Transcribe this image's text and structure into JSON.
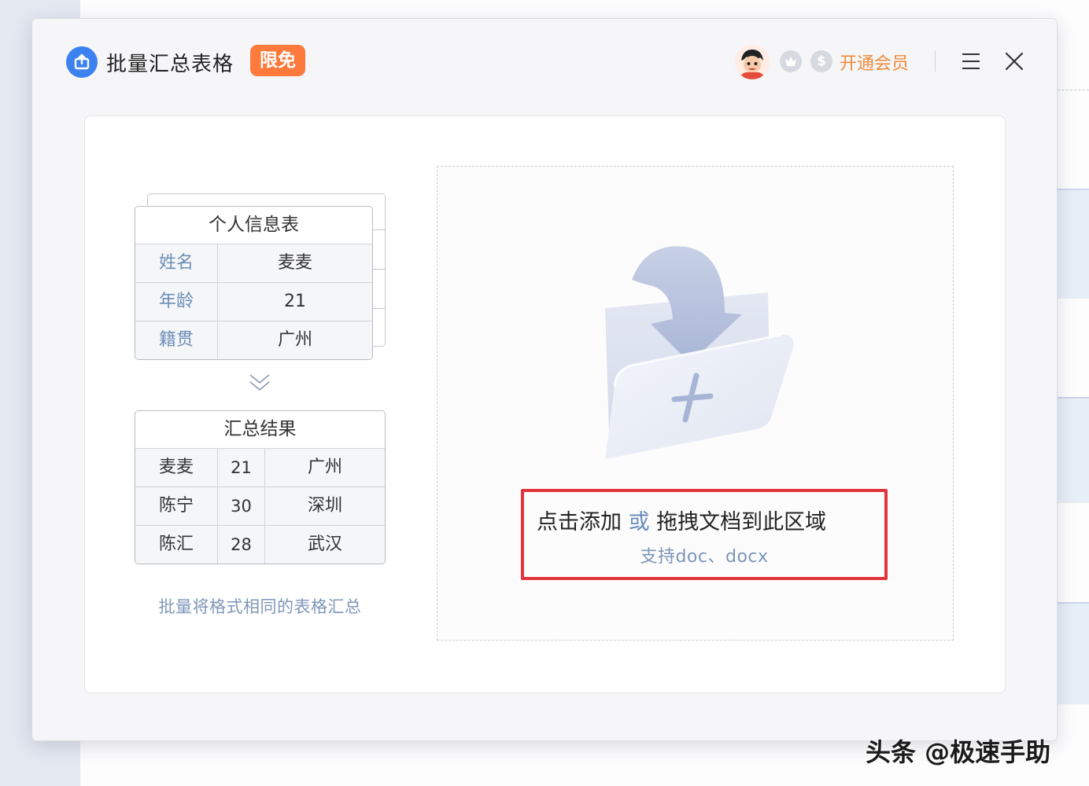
{
  "window": {
    "title": "批量汇总表格",
    "badge": "限免",
    "vip_label": "开通会员",
    "coin_symbol": "$"
  },
  "demo": {
    "source_table": {
      "title": "个人信息表",
      "rows": [
        {
          "key": "姓名",
          "value": "麦麦"
        },
        {
          "key": "年龄",
          "value": "21"
        },
        {
          "key": "籍贯",
          "value": "广州"
        }
      ]
    },
    "result_table": {
      "title": "汇总结果",
      "rows": [
        [
          "麦麦",
          "21",
          "广州"
        ],
        [
          "陈宁",
          "30",
          "深圳"
        ],
        [
          "陈汇",
          "28",
          "武汉"
        ]
      ]
    },
    "caption": "批量将格式相同的表格汇总"
  },
  "dropzone": {
    "hint_part1": "点击添加",
    "hint_or": "或",
    "hint_part2": "拖拽文档到此区域",
    "formats": "支持doc、docx"
  },
  "watermark": "头条 @极速手助",
  "colors": {
    "accent": "#3b82f0",
    "badge": "#ff7a3d",
    "vip": "#ef8a3a",
    "highlight_border": "#e0363b"
  }
}
